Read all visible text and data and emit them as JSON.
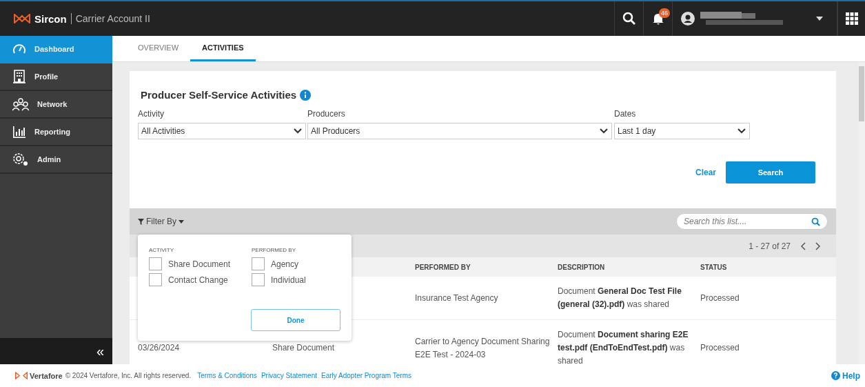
{
  "header": {
    "brand": "Sircon",
    "app_name": "Carrier Account II",
    "notification_count": "46"
  },
  "sidebar": {
    "items": [
      {
        "label": "Dashboard",
        "selected": true
      },
      {
        "label": "Profile",
        "selected": false
      },
      {
        "label": "Network",
        "selected": false
      },
      {
        "label": "Reporting",
        "selected": false
      },
      {
        "label": "Admin",
        "selected": false
      }
    ],
    "collapse": "«"
  },
  "tabs": [
    {
      "label": "OVERVIEW",
      "selected": false
    },
    {
      "label": "ACTIVITIES",
      "selected": true
    }
  ],
  "panel": {
    "title": "Producer Self-Service Activities",
    "filters": [
      {
        "label": "Activity",
        "value": "All Activities"
      },
      {
        "label": "Producers",
        "value": "All Producers"
      },
      {
        "label": "Dates",
        "value": "Last 1 day"
      }
    ],
    "clear": "Clear",
    "search": "Search"
  },
  "list": {
    "filter_by": "Filter By",
    "search_placeholder": "Search this list....",
    "pagination": "1 - 27 of 27",
    "columns": [
      "PERFORMED BY",
      "DESCRIPTION",
      "STATUS"
    ],
    "rows": [
      {
        "performed_by": "Insurance Test Agency",
        "description": "Document **General Doc Test File (general (32).pdf)** was shared",
        "status": "Processed"
      },
      {
        "date": "03/26/2024",
        "activity": "Share Document",
        "performed_by": "Carrier to Agency Document Sharing E2E Test - 2024-03",
        "description": "Document **Document sharing E2E test.pdf (EndToEndTest.pdf)** was shared",
        "status": "Processed"
      }
    ]
  },
  "filter_popup": {
    "groups": [
      {
        "title": "ACTIVITY",
        "options": [
          {
            "label": "Share Document",
            "checked": false
          },
          {
            "label": "Contact Change",
            "checked": false
          }
        ]
      },
      {
        "title": "PERFORMED BY",
        "options": [
          {
            "label": "Agency",
            "checked": false
          },
          {
            "label": "Individual",
            "checked": false
          }
        ]
      }
    ],
    "done": "Done"
  },
  "footer": {
    "brand": "Vertafore",
    "copyright": "© 2024 Vertafore, Inc. All rights reserved.",
    "links": [
      "Terms & Conditions",
      "Privacy Statement",
      "Early Adopter Program Terms"
    ],
    "help": "Help"
  }
}
